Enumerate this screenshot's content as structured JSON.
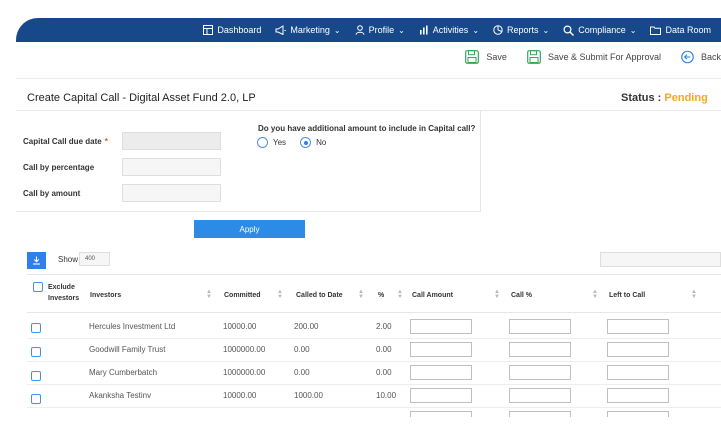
{
  "nav": {
    "items": [
      {
        "label": "Dashboard",
        "icon": "dashboard-icon",
        "dropdown": false
      },
      {
        "label": "Marketing",
        "icon": "megaphone-icon",
        "dropdown": true
      },
      {
        "label": "Profile",
        "icon": "user-icon",
        "dropdown": true
      },
      {
        "label": "Activities",
        "icon": "bar-chart-icon",
        "dropdown": true
      },
      {
        "label": "Reports",
        "icon": "pie-chart-icon",
        "dropdown": true
      },
      {
        "label": "Compliance",
        "icon": "search-gear-icon",
        "dropdown": true
      },
      {
        "label": "Data Room",
        "icon": "folder-icon",
        "dropdown": false
      }
    ]
  },
  "toolbar": {
    "save": "Save",
    "save_submit": "Save & Submit For Approval",
    "back": "Back"
  },
  "page": {
    "title": "Create Capital Call - Digital Asset Fund 2.0, LP",
    "status_label": "Status :",
    "status_value": "Pending"
  },
  "form": {
    "due_date_label": "Capital Call due date",
    "required_mark": "*",
    "percentage_label": "Call by percentage",
    "amount_label": "Call by amount",
    "question": "Do you have additional amount to include in Capital call?",
    "yes_label": "Yes",
    "no_label": "No",
    "selected": "No",
    "apply": "Apply"
  },
  "table_controls": {
    "show_label": "Show",
    "show_value": "400"
  },
  "table": {
    "headers": {
      "exclude": "Exclude Investors",
      "investors": "Investors",
      "committed": "Committed",
      "called_to_date": "Called to Date",
      "pct": "%",
      "call_amount": "Call Amount",
      "call_pct": "Call %",
      "left_to_call": "Left to Call"
    },
    "rows": [
      {
        "investor": "Hercules Investment Ltd",
        "committed": "10000.00",
        "called": "200.00",
        "pct": "2.00"
      },
      {
        "investor": "Goodwill Family Trust",
        "committed": "1000000.00",
        "called": "0.00",
        "pct": "0.00"
      },
      {
        "investor": "Mary Cumberbatch",
        "committed": "1000000.00",
        "called": "0.00",
        "pct": "0.00"
      },
      {
        "investor": "Akanksha Testinv",
        "committed": "10000.00",
        "called": "1000.00",
        "pct": "10.00"
      }
    ]
  },
  "colors": {
    "nav_bg": "#17498a",
    "primary": "#2d8be8",
    "status_pending": "#f5a623",
    "save_icon": "#3aa655",
    "back_icon": "#2f80ed"
  }
}
